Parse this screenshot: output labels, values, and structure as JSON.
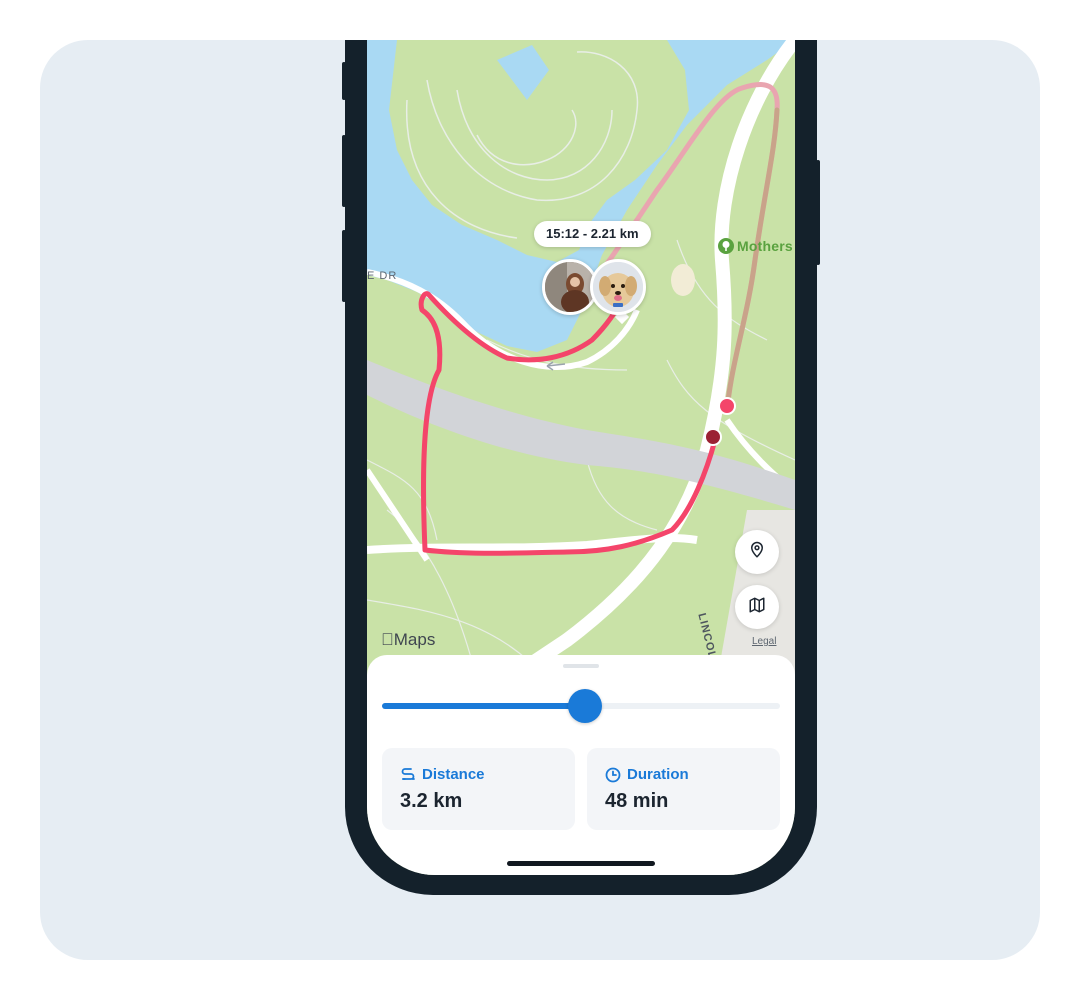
{
  "route_bubble": {
    "text": "15:12 - 2.21 km"
  },
  "map": {
    "park_label": "Mothers",
    "road_label_top": "E DR",
    "road_label_bottom": "LINCOLN",
    "attribution": "Maps",
    "legal": "Legal",
    "colors": {
      "route": "#f4456a",
      "route_faded": "#d9a08c",
      "water": "#a9d9f3",
      "park": "#c9e2a7",
      "road": "#d2d4d8"
    }
  },
  "controls": {
    "location_icon": "pin-icon",
    "map_mode_icon": "map-icon"
  },
  "timeline": {
    "progress": 0.51
  },
  "stats": {
    "distance": {
      "label": "Distance",
      "value": "3.2 km",
      "icon": "route-icon"
    },
    "duration": {
      "label": "Duration",
      "value": "48 min",
      "icon": "clock-icon"
    }
  },
  "accent": "#1a7ad8"
}
